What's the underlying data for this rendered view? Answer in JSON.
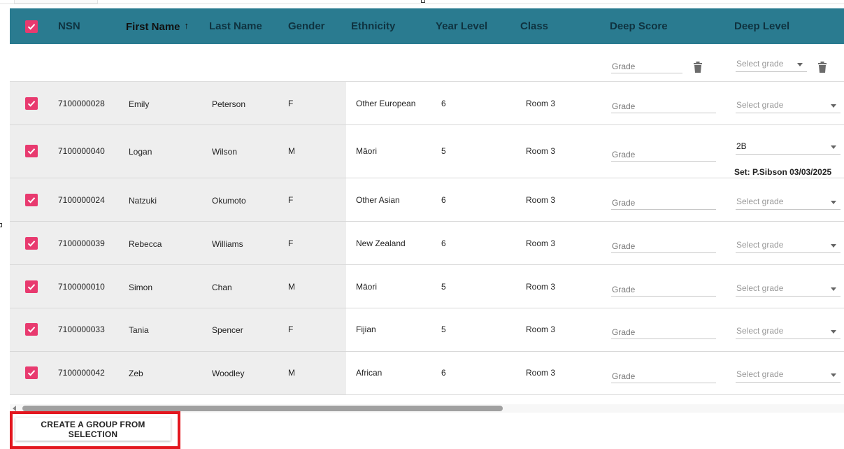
{
  "header": {
    "columns": {
      "nsn": "NSN",
      "first_name": "First Name",
      "last_name": "Last Name",
      "gender": "Gender",
      "ethnicity": "Ethnicity",
      "year_level": "Year Level",
      "class": "Class",
      "deep_score": "Deep Score",
      "deep_level": "Deep Level"
    },
    "sort_icon": "↑",
    "sort_column": "first_name"
  },
  "filters": {
    "grade_placeholder": "Grade",
    "select_placeholder": "Select grade"
  },
  "rows": [
    {
      "nsn": "7100000028",
      "first": "Emily",
      "last": "Peterson",
      "gender": "F",
      "ethnicity": "Other European",
      "year": "6",
      "class": "Room 3",
      "score": "Grade",
      "level": "Select grade"
    },
    {
      "nsn": "7100000040",
      "first": "Logan",
      "last": "Wilson",
      "gender": "M",
      "ethnicity": "Māori",
      "year": "5",
      "class": "Room 3",
      "score": "Grade",
      "level": "2B",
      "note": "Set: P.Sibson 03/03/2025"
    },
    {
      "nsn": "7100000024",
      "first": "Natzuki",
      "last": "Okumoto",
      "gender": "F",
      "ethnicity": "Other Asian",
      "year": "6",
      "class": "Room 3",
      "score": "Grade",
      "level": "Select grade"
    },
    {
      "nsn": "7100000039",
      "first": "Rebecca",
      "last": "Williams",
      "gender": "F",
      "ethnicity": "New Zealand",
      "year": "6",
      "class": "Room 3",
      "score": "Grade",
      "level": "Select grade"
    },
    {
      "nsn": "7100000010",
      "first": "Simon",
      "last": "Chan",
      "gender": "M",
      "ethnicity": "Māori",
      "year": "5",
      "class": "Room 3",
      "score": "Grade",
      "level": "Select grade"
    },
    {
      "nsn": "7100000033",
      "first": "Tania",
      "last": "Spencer",
      "gender": "F",
      "ethnicity": "Fijian",
      "year": "5",
      "class": "Room 3",
      "score": "Grade",
      "level": "Select grade"
    },
    {
      "nsn": "7100000042",
      "first": "Zeb",
      "last": "Woodley",
      "gender": "M",
      "ethnicity": "African",
      "year": "6",
      "class": "Room 3",
      "score": "Grade",
      "level": "Select grade"
    }
  ],
  "actions": {
    "create_group": "CREATE A GROUP FROM SELECTION"
  },
  "colors": {
    "header_bg": "#2a7b90",
    "checkbox": "#e83a6f",
    "highlight": "#e3171f"
  }
}
